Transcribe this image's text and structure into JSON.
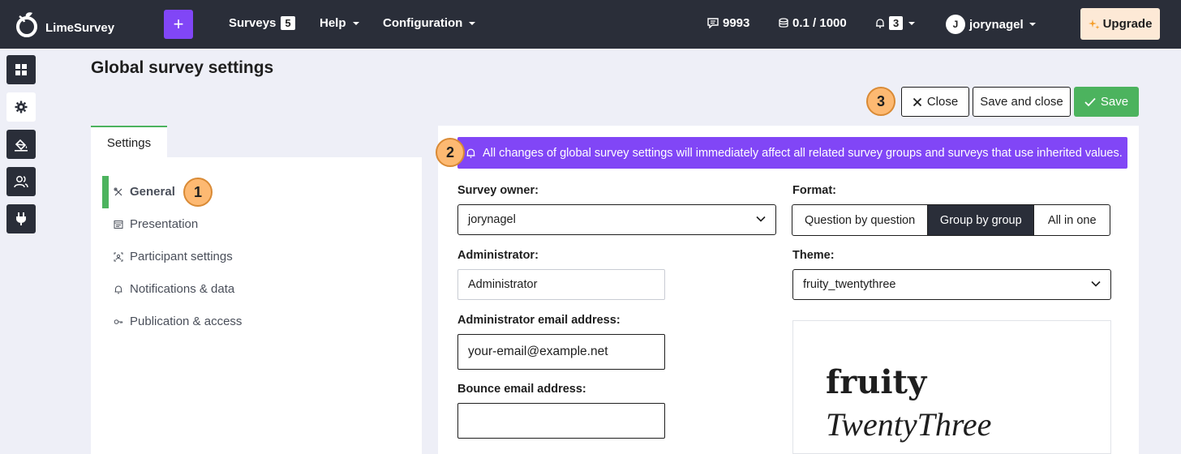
{
  "topbar": {
    "brand": "LimeSurvey",
    "plus_label": "+",
    "surveys_label": "Surveys",
    "surveys_count": "5",
    "help_label": "Help",
    "configuration_label": "Configuration",
    "responses_count": "9993",
    "storage": "0.1 / 1000",
    "notifications_count": "3",
    "user_initial": "J",
    "username": "jorynagel",
    "upgrade_label": "Upgrade"
  },
  "rail": {
    "icons": [
      "dashboard-icon",
      "gear-icon",
      "paint-bucket-icon",
      "users-icon",
      "plugin-icon"
    ]
  },
  "page": {
    "title": "Global survey settings",
    "close_label": "Close",
    "save_close_label": "Save and close",
    "save_label": "Save"
  },
  "callouts": {
    "one": "1",
    "two": "2",
    "three": "3"
  },
  "left_nav": {
    "tab_label": "Settings",
    "items": [
      {
        "label": "General",
        "icon": "tools-icon"
      },
      {
        "label": "Presentation",
        "icon": "presentation-icon"
      },
      {
        "label": "Participant settings",
        "icon": "participant-icon"
      },
      {
        "label": "Notifications & data",
        "icon": "bell-icon"
      },
      {
        "label": "Publication & access",
        "icon": "key-icon"
      }
    ]
  },
  "alert": {
    "text": "All changes of global survey settings will immediately affect all related survey groups and surveys that use inherited values."
  },
  "form": {
    "survey_owner_label": "Survey owner:",
    "survey_owner_value": "jorynagel",
    "administrator_label": "Administrator:",
    "administrator_value": "Administrator",
    "admin_email_label": "Administrator email address:",
    "admin_email_value": "your-email@example.net",
    "bounce_email_label": "Bounce email address:",
    "bounce_email_value": "",
    "format_label": "Format:",
    "format_options": [
      "Question by question",
      "Group by group",
      "All in one"
    ],
    "format_selected": "Group by group",
    "theme_label": "Theme:",
    "theme_value": "fruity_twentythree",
    "theme_preview_line1": "fruity",
    "theme_preview_line2": "TwentyThree"
  },
  "colors": {
    "nav_bg": "#2a2e39",
    "accent_purple": "#8146f6",
    "accent_green": "#4cb35e",
    "callout_orange": "#fdb972",
    "upgrade_bg": "#fde9d6"
  }
}
